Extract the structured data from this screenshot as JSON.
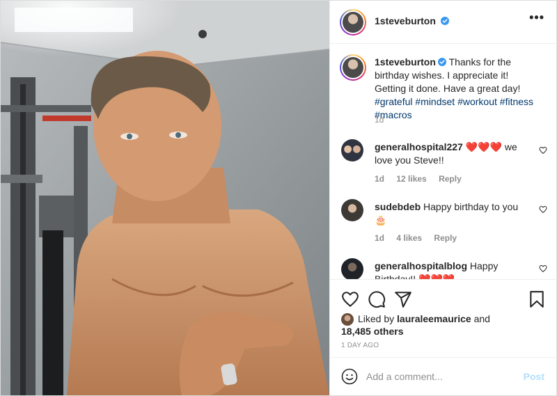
{
  "post": {
    "author": "1steveburton",
    "more_icon": "more-horizontal-icon",
    "caption_text": "Thanks for the birthday wishes. I appreciate it! Getting it done. Have a great day!",
    "hashtags": [
      "#grateful",
      "#mindset",
      "#workout",
      "#fitness",
      "#macros"
    ],
    "caption_age": "1d"
  },
  "comments": [
    {
      "user": "generalhospital227",
      "text_hearts": "❤️❤️❤️",
      "text": "we love you Steve!!",
      "age": "1d",
      "likes": "12 likes",
      "reply": "Reply"
    },
    {
      "user": "sudebdeb",
      "text": "Happy birthday to you",
      "text_emoji": "🎂",
      "age": "1d",
      "likes": "4 likes",
      "reply": "Reply"
    },
    {
      "user": "generalhospitalblog",
      "text": "Happy Birthday!!",
      "text_hearts": "❤️❤️❤️"
    }
  ],
  "actions": {
    "like_icon": "heart-icon",
    "comment_icon": "comment-icon",
    "share_icon": "share-icon",
    "save_icon": "bookmark-icon"
  },
  "likes": {
    "prefix": "Liked by",
    "user": "lauraleemaurice",
    "and": "and",
    "others": "18,485 others"
  },
  "posted_date": "1 DAY AGO",
  "add_comment": {
    "placeholder": "Add a comment...",
    "post_label": "Post",
    "emoji_icon": "smiley-icon"
  },
  "colors": {
    "link": "#00376b",
    "verified": "#3897f0",
    "muted": "#8e8e8e",
    "post_disabled": "#b2dffc",
    "heart": "#ed4956"
  }
}
